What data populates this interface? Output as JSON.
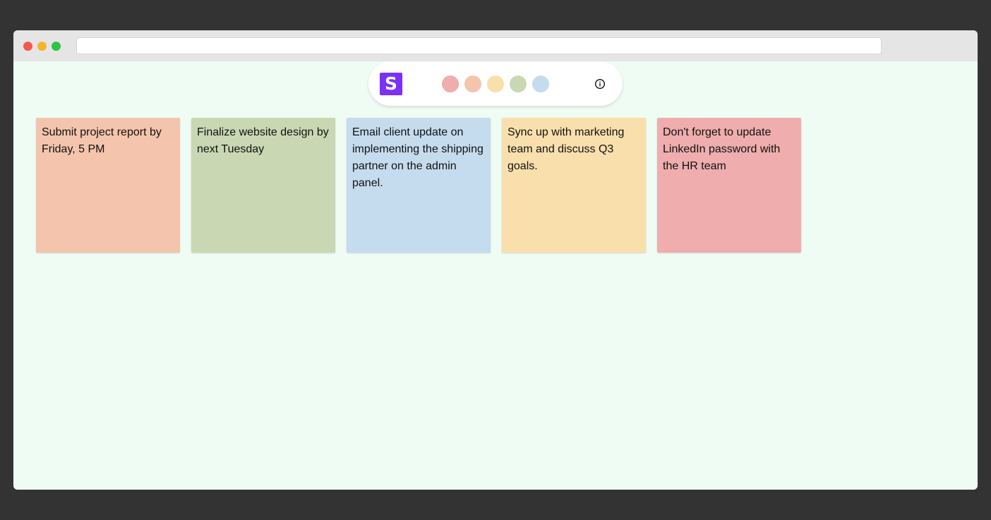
{
  "colors": {
    "pink": "#efadae",
    "peach": "#f5c4ad",
    "yellow": "#f9dfac",
    "green": "#c9d7b3",
    "blue": "#c5dcee"
  },
  "toolbar": {
    "logo_letter": "S",
    "swatches": [
      {
        "name": "pink",
        "color": "#efadae"
      },
      {
        "name": "peach",
        "color": "#f5c4ad"
      },
      {
        "name": "yellow",
        "color": "#f9dfac"
      },
      {
        "name": "green",
        "color": "#c9d7b3"
      },
      {
        "name": "blue",
        "color": "#c5dcee"
      }
    ],
    "info_icon": "info-circle-icon"
  },
  "notes": [
    {
      "text": "Submit project report by Friday, 5 PM",
      "color": "#f5c4ad"
    },
    {
      "text": "Finalize website design by next Tuesday",
      "color": "#c9d7b3"
    },
    {
      "text": "Email client update on implementing the shipping partner on the admin panel.",
      "color": "#c5dcee"
    },
    {
      "text": "Sync up with marketing team and discuss Q3 goals.",
      "color": "#f9dfac"
    },
    {
      "text": "Don't forget to update LinkedIn password with the HR team",
      "color": "#efadae"
    }
  ]
}
